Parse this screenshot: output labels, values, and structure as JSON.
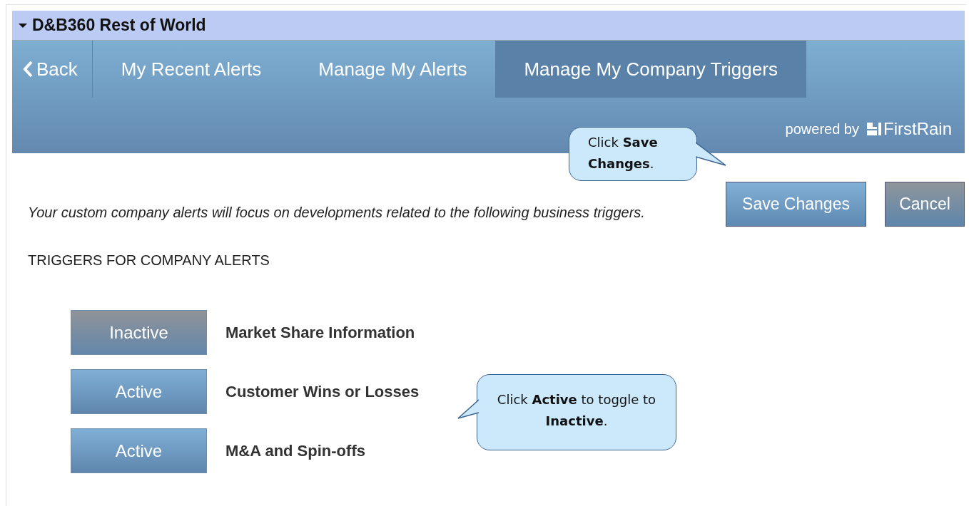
{
  "header": {
    "title": "D&B360 Rest of World",
    "expanded": true
  },
  "nav": {
    "back": "Back",
    "tabs": [
      {
        "label": "My Recent Alerts",
        "selected": false
      },
      {
        "label": "Manage My Alerts",
        "selected": false
      },
      {
        "label": "Manage My Company Triggers",
        "selected": true
      }
    ],
    "powered_by": "powered by",
    "brand": "FirstRain"
  },
  "intro": "Your custom company alerts will focus on developments related to the following business triggers.",
  "buttons": [
    {
      "label": "Save Changes",
      "kind": "primary"
    },
    {
      "label": "Cancel",
      "kind": "secondary"
    }
  ],
  "section_title": "TRIGGERS FOR COMPANY ALERTS",
  "triggers": [
    {
      "state": "Inactive",
      "active": false,
      "name": "Market Share Information"
    },
    {
      "state": "Active",
      "active": true,
      "name": "Customer Wins or Losses"
    },
    {
      "state": "Active",
      "active": true,
      "name": "M&A and Spin-offs"
    }
  ],
  "callouts": [
    {
      "text": "Click **Save Changes**.",
      "kind": "save"
    },
    {
      "text": "Click **Active** to toggle to **Inactive**.",
      "kind": "toggle"
    }
  ]
}
